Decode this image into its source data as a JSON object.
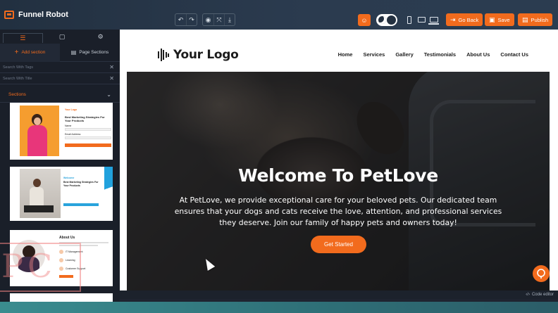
{
  "app": {
    "title": "Funnel Robot"
  },
  "toolbar": {
    "undo_icon": "undo-icon",
    "redo_icon": "redo-icon",
    "preview_icon": "eye-icon",
    "fullscreen_icon": "expand-icon",
    "download_icon": "download-icon",
    "go_back_label": "Go Back",
    "save_label": "Save",
    "publish_label": "Publish"
  },
  "sidebar": {
    "add_section_label": "Add section",
    "page_sections_label": "Page Sections",
    "search_tags_placeholder": "Search With Tags",
    "search_title_placeholder": "Search With Title",
    "sections_label": "Sections",
    "thumbnails": [
      {
        "logo": "Your Logo",
        "heading": "Best Marketing Strategies For Your Products",
        "field1": "Name",
        "field2": "Email Address"
      },
      {
        "heading": "Welcome",
        "subheading": "Best Marketing Strategies For Your Products"
      },
      {
        "heading": "About Us",
        "items": [
          "IT Management",
          "Learning",
          "Customer Support"
        ]
      }
    ]
  },
  "site": {
    "logo_text": "Your Logo",
    "nav": [
      "Home",
      "Services",
      "Gallery",
      "Testimonials",
      "About Us",
      "Contact Us"
    ],
    "hero_title": "Welcome To PetLove",
    "hero_text": "At PetLove, we provide exceptional care for your beloved pets. Our dedicated team ensures that your dogs and cats receive the love, attention, and professional services they deserve. Join our family of happy pets and owners today!",
    "hero_cta": "Get Started"
  },
  "footer": {
    "code_editor_label": "Code editor"
  },
  "colors": {
    "accent": "#f26b1d",
    "topbar": "#2b3b4f",
    "sidebar": "#1a1f29"
  }
}
